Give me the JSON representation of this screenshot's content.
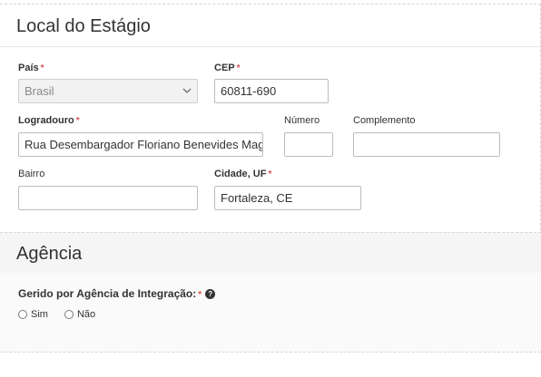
{
  "local": {
    "title": "Local do Estágio",
    "pais": {
      "label": "País",
      "required": "*",
      "value": "Brasil"
    },
    "cep": {
      "label": "CEP",
      "required": "*",
      "value": "60811-690"
    },
    "logradouro": {
      "label": "Logradouro",
      "required": "*",
      "value": "Rua Desembargador Floriano Benevides Magal"
    },
    "numero": {
      "label": "Número",
      "value": ""
    },
    "complemento": {
      "label": "Complemento",
      "value": ""
    },
    "bairro": {
      "label": "Bairro",
      "value": ""
    },
    "cidade": {
      "label": "Cidade, UF",
      "required": "*",
      "value": "Fortaleza, CE"
    }
  },
  "agencia": {
    "title": "Agência",
    "question": "Gerido por Agência de Integração:",
    "required": "*",
    "help_icon": "question-circle-icon",
    "options": [
      "Sim",
      "Não"
    ]
  }
}
